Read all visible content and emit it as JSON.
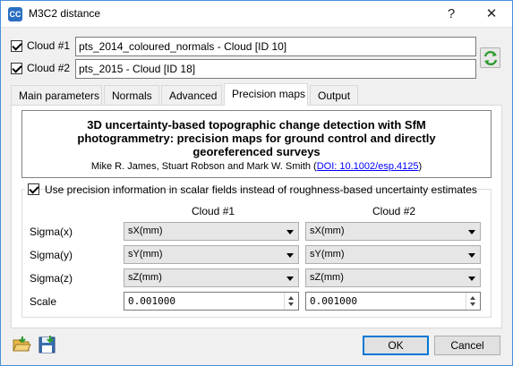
{
  "window": {
    "title": "M3C2 distance",
    "app_icon_text": "CC",
    "help_label": "?",
    "close_label": "✕"
  },
  "clouds": {
    "cloud1_label": "Cloud #1",
    "cloud1_value": "pts_2014_coloured_normals - Cloud [ID 10]",
    "cloud2_label": "Cloud #2",
    "cloud2_value": "pts_2015 - Cloud [ID 18]",
    "swap_icon": "swap-arrows-icon"
  },
  "tabs": [
    {
      "label": "Main parameters",
      "active": false
    },
    {
      "label": "Normals",
      "active": false
    },
    {
      "label": "Advanced",
      "active": false
    },
    {
      "label": "Precision maps",
      "active": true
    },
    {
      "label": "Output",
      "active": false
    }
  ],
  "reference": {
    "title": "3D uncertainty-based topographic change detection with SfM photogrammetry: precision maps for ground control and directly georeferenced surveys",
    "authors": "Mike R. James, Stuart Robson and Mark W. Smith (",
    "doi": "DOI: 10.1002/esp.4125",
    "close_paren": ")"
  },
  "precision": {
    "checkbox_label": "Use precision information in scalar fields instead of roughness-based uncertainty estimates",
    "col1_header": "Cloud #1",
    "col2_header": "Cloud #2",
    "rows": [
      {
        "label": "Sigma(x)",
        "c1": "sX(mm)",
        "c2": "sX(mm)"
      },
      {
        "label": "Sigma(y)",
        "c1": "sY(mm)",
        "c2": "sY(mm)"
      },
      {
        "label": "Sigma(z)",
        "c1": "sZ(mm)",
        "c2": "sZ(mm)"
      }
    ],
    "scale_label": "Scale",
    "scale1": "0.001000",
    "scale2": "0.001000"
  },
  "footer": {
    "ok_label": "OK",
    "cancel_label": "Cancel",
    "load_icon": "open-folder-icon",
    "save_icon": "save-disk-icon"
  },
  "colors": {
    "accent": "#0078d7",
    "link": "#0000ff"
  }
}
